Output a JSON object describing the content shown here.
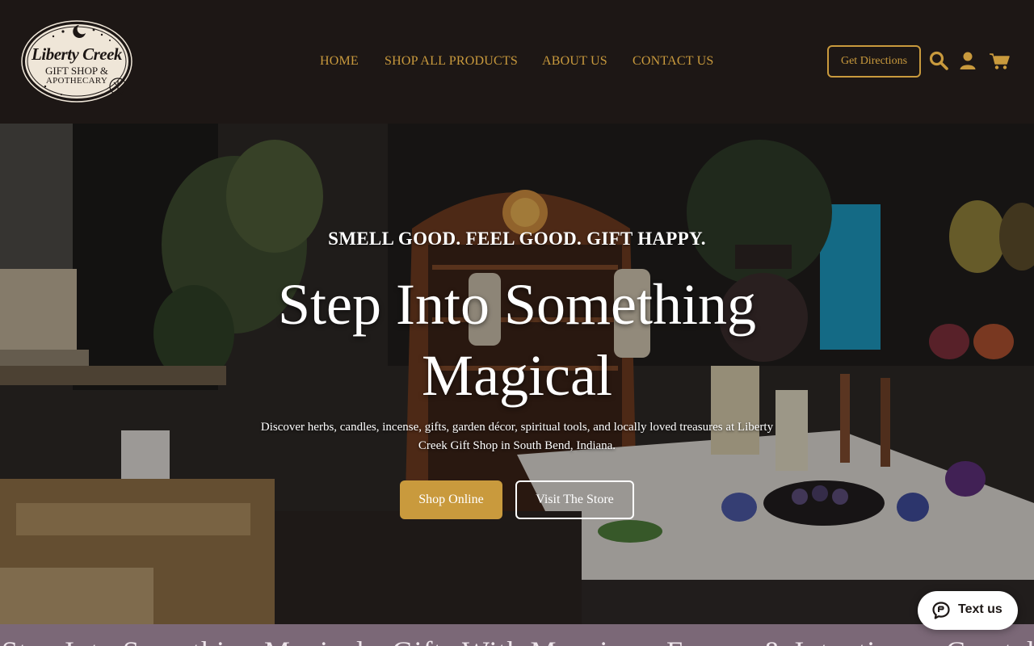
{
  "brand": {
    "name_line1": "Liberty Creek",
    "name_line2": "GIFT SHOP &",
    "name_line3": "APOTHECARY"
  },
  "nav": {
    "items": [
      {
        "label": "HOME"
      },
      {
        "label": "SHOP ALL PRODUCTS"
      },
      {
        "label": "ABOUT US"
      },
      {
        "label": "CONTACT US"
      }
    ]
  },
  "header": {
    "directions_label": "Get Directions",
    "icons": [
      "search-icon",
      "account-icon",
      "cart-icon"
    ]
  },
  "hero": {
    "eyebrow": "SMELL GOOD. FEEL GOOD. GIFT HAPPY.",
    "headline": "Step Into Something Magical",
    "subtext": "Discover herbs, candles, incense, gifts, garden décor, spiritual tools, and locally loved treasures at Liberty Creek Gift Shop in South Bend, Indiana.",
    "primary_button": "Shop Online",
    "secondary_button": "Visit The Store"
  },
  "marquee": {
    "text": "Step Into Something Magical • Gifts With Meaning • Energy & Intentions • Crystal Treasures • Fun Mi"
  },
  "chat": {
    "label": "Text us"
  },
  "colors": {
    "header_bg": "#1d1715",
    "accent_gold": "#c99a3d",
    "marquee_bg": "#7b6877",
    "white": "#ffffff"
  }
}
